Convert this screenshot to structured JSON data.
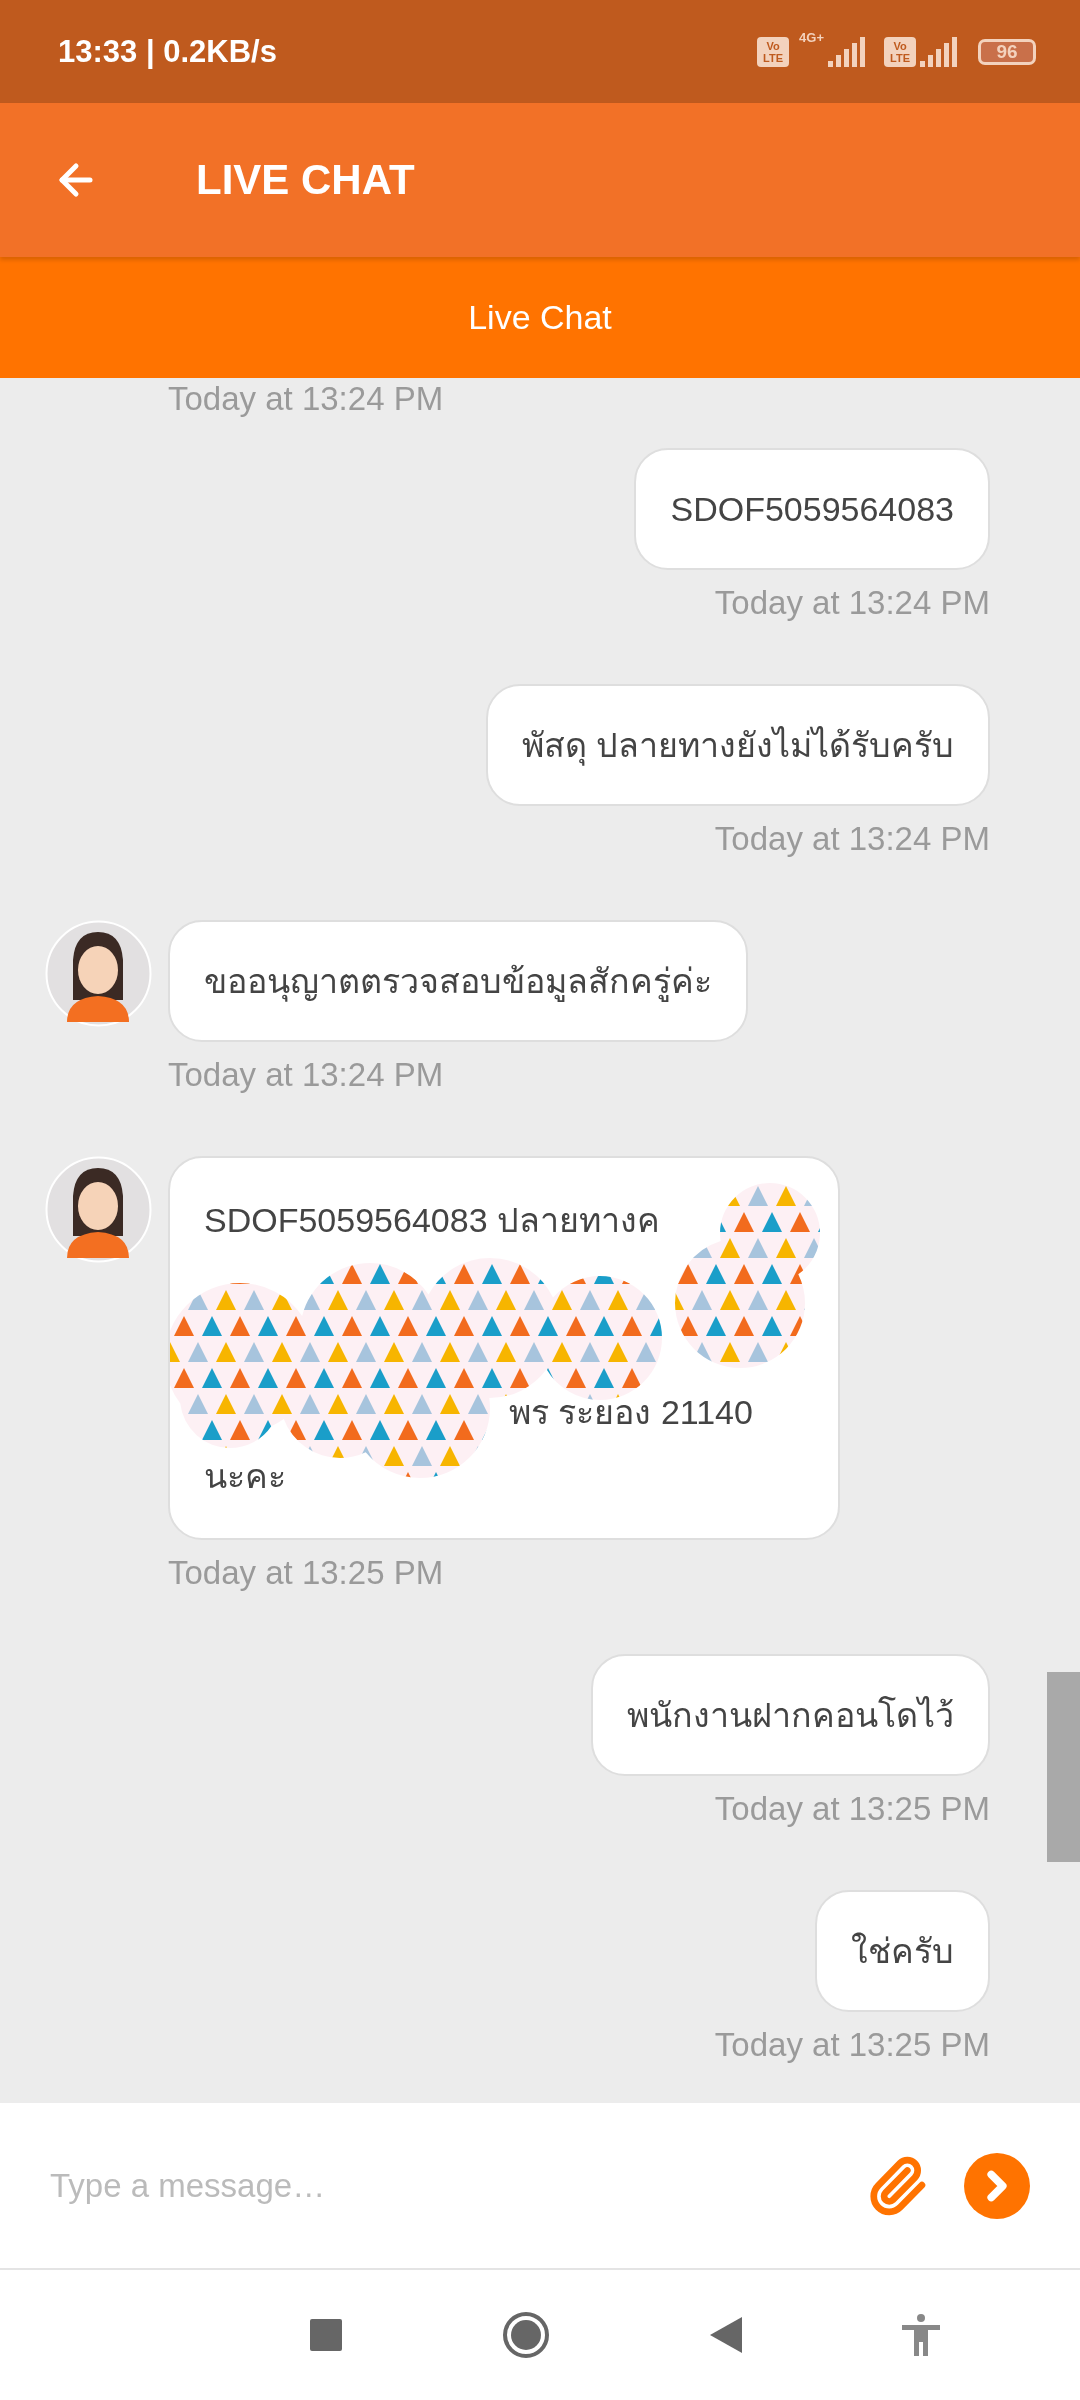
{
  "status_bar": {
    "time": "13:33 | 0.2KB/s",
    "sims": [
      {
        "badge_top": "Vo",
        "badge_bottom": "LTE",
        "network": "4G+"
      },
      {
        "badge_top": "Vo",
        "badge_bottom": "LTE"
      }
    ],
    "battery": "96"
  },
  "header": {
    "title": "LIVE CHAT"
  },
  "subheader": {
    "title": "Live Chat"
  },
  "chat": {
    "top_time": "Today at 13:24 PM",
    "messages": [
      {
        "sent": true,
        "kind": "text",
        "text": "SDOF5059564083",
        "time": "Today at 13:24 PM"
      },
      {
        "sent": true,
        "kind": "text",
        "text": "พัสดุ ปลายทางยังไม่ได้รับครับ",
        "time": "Today at 13:24 PM"
      },
      {
        "sent": false,
        "kind": "text",
        "text": "ขออนุญาตตรวจสอบข้อมูลสักครู่ค่ะ",
        "time": "Today at 13:24 PM"
      },
      {
        "sent": false,
        "kind": "redacted",
        "lines": [
          {
            "kind": "visible",
            "text": "SDOF5059564083 ปลายทางค"
          },
          {
            "kind": "hidden"
          },
          {
            "kind": "hidden"
          },
          {
            "kind": "tail",
            "text": "พร ระยอง 21140"
          },
          {
            "kind": "visible",
            "text": "นะคะ"
          }
        ],
        "time": "Today at 13:25 PM"
      },
      {
        "sent": true,
        "kind": "text",
        "text": "พนักงานฝากคอนโดไว้",
        "time": "Today at 13:25 PM"
      },
      {
        "sent": true,
        "kind": "text",
        "text": "ใช่ครับ",
        "time": "Today at 13:25 PM"
      }
    ]
  },
  "composer": {
    "placeholder": "Type a message…"
  }
}
